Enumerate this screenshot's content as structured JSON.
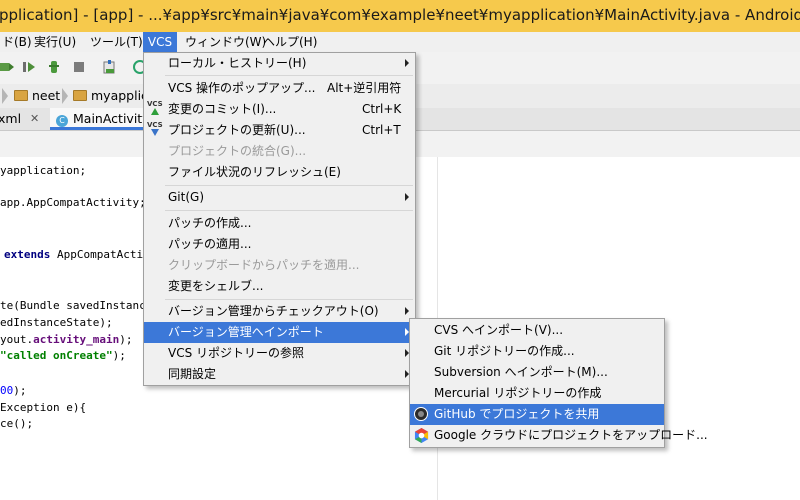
{
  "window": {
    "title": "pplication] - [app] - ...¥app¥src¥main¥java¥com¥example¥neet¥myapplication¥MainActivity.java - Android S"
  },
  "menubar": {
    "items": [
      "ド(B)",
      "実行(U)",
      "ツール(T)",
      "VCS",
      "ウィンドウ(W)",
      "ヘルプ(H)"
    ],
    "active": "VCS"
  },
  "breadcrumb": {
    "items": [
      "neet",
      "myapplic"
    ]
  },
  "tabs": {
    "items": [
      {
        "label": "xml"
      },
      {
        "label": "MainActivity"
      }
    ]
  },
  "editor": {
    "lines": {
      "l1": "yapplication;",
      "l2": "app.AppCompatActivity;",
      "l3_kw": "extends",
      "l3_rest": " AppCompatActiv",
      "l4": "te(Bundle savedInstanceS",
      "l5": "edInstanceState);",
      "l6_pre": "yout.",
      "l6_fld": "activity_main",
      "l6_post": ");",
      "l7_str": "\"called onCreate\"",
      "l7_post": ");",
      "l8_num": "00",
      "l8_post": ");",
      "l9": "Exception e){",
      "l10": "ce();"
    }
  },
  "vcs_menu": {
    "items": [
      {
        "label": "ローカル・ヒストリー(H)",
        "submenu": true
      },
      {
        "label": "VCS 操作のポップアップ...",
        "shortcut": "Alt+逆引用符"
      },
      {
        "label": "変更のコミット(I)...",
        "shortcut": "Ctrl+K",
        "icon": "vcs-commit-icon"
      },
      {
        "label": "プロジェクトの更新(U)...",
        "shortcut": "Ctrl+T",
        "icon": "vcs-update-icon"
      },
      {
        "label": "プロジェクトの統合(G)...",
        "disabled": true
      },
      {
        "label": "ファイル状況のリフレッシュ(E)"
      },
      {
        "label": "Git(G)",
        "submenu": true
      },
      {
        "label": "パッチの作成..."
      },
      {
        "label": "パッチの適用..."
      },
      {
        "label": "クリップボードからパッチを適用...",
        "disabled": true
      },
      {
        "label": "変更をシェルブ..."
      },
      {
        "label": "バージョン管理からチェックアウト(O)",
        "submenu": true
      },
      {
        "label": "バージョン管理へインポート",
        "submenu": true,
        "highlighted": true
      },
      {
        "label": "VCS リポジトリーの参照",
        "submenu": true
      },
      {
        "label": "同期設定",
        "submenu": true
      }
    ]
  },
  "import_submenu": {
    "items": [
      {
        "label": "CVS へインポート(V)..."
      },
      {
        "label": "Git リポジトリーの作成..."
      },
      {
        "label": "Subversion へインポート(M)..."
      },
      {
        "label": "Mercurial リポジトリーの作成"
      },
      {
        "label": "GitHub でプロジェクトを共用",
        "highlighted": true,
        "icon": "github-icon"
      },
      {
        "label": "Google クラウドにプロジェクトをアップロード...",
        "icon": "google-cloud-icon"
      }
    ]
  },
  "colors": {
    "title_bar": "#f6c94c",
    "menu_highlight": "#3c78d8",
    "menu_bg": "#f0f0f0"
  }
}
